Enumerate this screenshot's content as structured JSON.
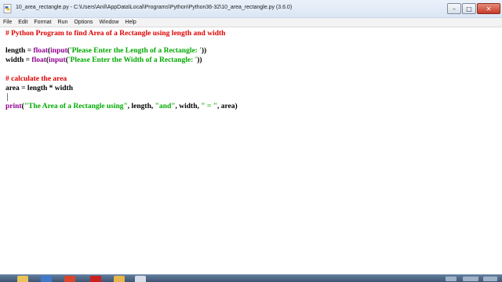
{
  "window": {
    "title": "10_area_rectangle.py - C:\\Users\\Anil\\AppData\\Local\\Programs\\Python\\Python36-32\\10_area_rectangle.py (3.6.0)",
    "icon": "python-file-icon",
    "controls": {
      "minimize_symbol": "–",
      "maximize_symbol": "□",
      "close_symbol": "✕"
    }
  },
  "menu": {
    "items": [
      "File",
      "Edit",
      "Format",
      "Run",
      "Options",
      "Window",
      "Help"
    ]
  },
  "editor": {
    "line_1": {
      "comment": "# Python Program to find Area of a Rectangle using length and width"
    },
    "line_2": {
      "pre": "length = ",
      "builtin_1": "float",
      "p1": "(",
      "builtin_2": "input",
      "p2": "(",
      "string": "'Please Enter the Length of a Rectangle: '",
      "post": "))"
    },
    "line_3": {
      "pre": "width = ",
      "builtin_1": "float",
      "p1": "(",
      "builtin_2": "input",
      "p2": "(",
      "string": "'Please Enter the Width of a Rectangle: '",
      "post": "))"
    },
    "line_4": {
      "comment": "# calculate the area"
    },
    "line_5": {
      "code": "area = length * width"
    },
    "line_6": {
      "builtin": "print",
      "p1": "(",
      "s1": "\"The Area of a Rectangle using\"",
      "m1": ", length, ",
      "s2": "\"and\"",
      "m2": ", width, ",
      "s3": "\" = \"",
      "end": ", area)"
    }
  },
  "colors": {
    "comment": "#dd0000",
    "builtin": "#900090",
    "string": "#00aa00",
    "keyword_default": "#000000",
    "taskbar": "#4b6482"
  },
  "taskbar": {
    "items": [
      "windows-explorer-icon",
      "python-shell-icon",
      "office-icon",
      "opera-icon",
      "folder-icon",
      "idle-icon"
    ]
  }
}
